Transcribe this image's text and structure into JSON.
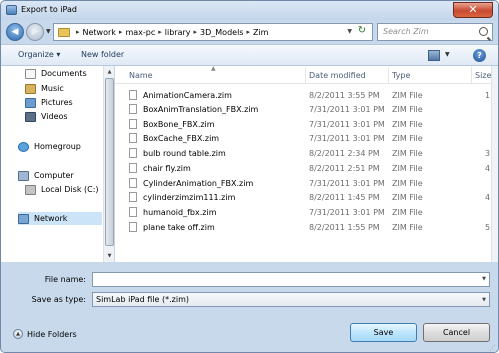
{
  "window": {
    "title": "Export to iPad",
    "close_glyph": "✕"
  },
  "address": {
    "back_glyph": "◀",
    "fwd_glyph": "▶",
    "crumbs": [
      "Network",
      "max-pc",
      "library",
      "3D_Models",
      "Zim"
    ],
    "refresh_glyph": "↻",
    "search_placeholder": "Search Zim"
  },
  "toolbar": {
    "organize_label": "Organize ▾",
    "new_folder_label": "New folder",
    "help_glyph": "?"
  },
  "nav": {
    "items": [
      {
        "label": "Documents",
        "icon": "documents-icon"
      },
      {
        "label": "Music",
        "icon": "music-icon"
      },
      {
        "label": "Pictures",
        "icon": "pictures-icon"
      },
      {
        "label": "Videos",
        "icon": "videos-icon"
      },
      {
        "label": "Homegroup",
        "icon": "homegroup-icon"
      },
      {
        "label": "Computer",
        "icon": "computer-icon"
      },
      {
        "label": "Local Disk (C:)",
        "icon": "disk-icon"
      },
      {
        "label": "Network",
        "icon": "network-icon",
        "selected": true
      }
    ]
  },
  "columns": {
    "name": "Name",
    "date": "Date modified",
    "type": "Type",
    "size": "Size"
  },
  "files": [
    {
      "name": "AnimationCamera.zim",
      "date": "8/2/2011 3:55 PM",
      "type": "ZIM File",
      "size": "1"
    },
    {
      "name": "BoxAnimTranslation_FBX.zim",
      "date": "7/31/2011 3:01 PM",
      "type": "ZIM File",
      "size": ""
    },
    {
      "name": "BoxBone_FBX.zim",
      "date": "7/31/2011 3:01 PM",
      "type": "ZIM File",
      "size": ""
    },
    {
      "name": "BoxCache_FBX.zim",
      "date": "7/31/2011 3:01 PM",
      "type": "ZIM File",
      "size": ""
    },
    {
      "name": "bulb round table.zim",
      "date": "8/2/2011 2:34 PM",
      "type": "ZIM File",
      "size": "3"
    },
    {
      "name": "chair fly.zim",
      "date": "8/2/2011 2:51 PM",
      "type": "ZIM File",
      "size": "4"
    },
    {
      "name": "CylinderAnimation_FBX.zim",
      "date": "7/31/2011 3:01 PM",
      "type": "ZIM File",
      "size": ""
    },
    {
      "name": "cylinderzimzim111.zim",
      "date": "8/2/2011 1:45 PM",
      "type": "ZIM File",
      "size": "4"
    },
    {
      "name": "humanoid_fbx.zim",
      "date": "7/31/2011 3:01 PM",
      "type": "ZIM File",
      "size": ""
    },
    {
      "name": "plane take off.zim",
      "date": "8/2/2011 1:55 PM",
      "type": "ZIM File",
      "size": "5"
    }
  ],
  "form": {
    "file_name_label": "File name:",
    "file_name_value": "",
    "save_type_label": "Save as type:",
    "save_type_value": "SimLab iPad file (*.zim)"
  },
  "footer": {
    "hide_folders_label": "Hide Folders",
    "save_label": "Save",
    "cancel_label": "Cancel"
  }
}
